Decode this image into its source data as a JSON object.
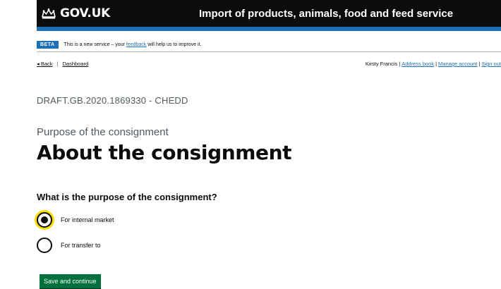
{
  "header": {
    "logo_text": "GOV.UK",
    "service_name": "Import of products, animals, food and feed service"
  },
  "phase_banner": {
    "tag": "BETA",
    "text_before": "This is a new service – your ",
    "feedback_link": "feedback",
    "text_after": " will help us to improve it."
  },
  "nav": {
    "back": "Back",
    "separator": "|",
    "dashboard": "Dashboard",
    "user_name": "Kirsty Francis",
    "address_book": "Address book",
    "manage_account": "Manage account",
    "sign_out": "Sign out"
  },
  "reference": "DRAFT.GB.2020.1869330 - CHEDD",
  "caption": "Purpose of the consignment",
  "title": "About the consignment",
  "question": "What is the purpose of the consignment?",
  "options": [
    {
      "label": "For internal market",
      "selected": true
    },
    {
      "label": "For transfer to",
      "selected": false
    }
  ],
  "button": {
    "label": "Save and continue"
  },
  "colors": {
    "header_bg": "#0b0c0c",
    "header_bar": "#1d70b8",
    "link": "#1d70b8",
    "focus": "#ffdd00",
    "button": "#00703c"
  },
  "icons": {
    "logo": "crown-icon",
    "back": "back-arrow-icon"
  }
}
